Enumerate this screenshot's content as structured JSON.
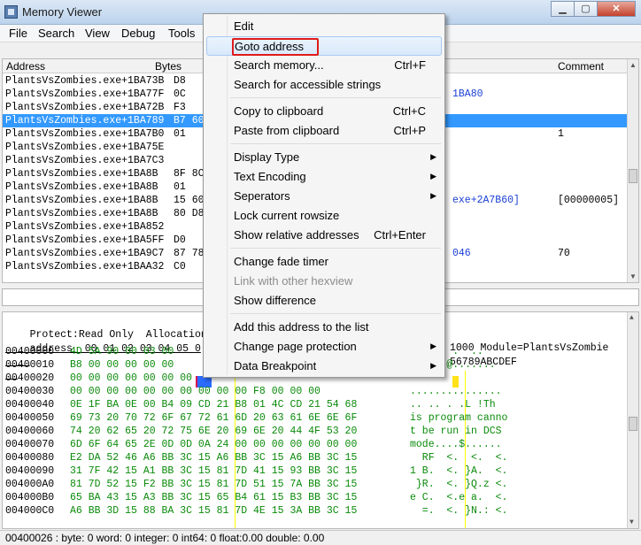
{
  "window": {
    "title": "Memory Viewer",
    "buttons": {
      "minimize": "▁",
      "maximize": "▢",
      "close": "✕"
    }
  },
  "menu": [
    "File",
    "Search",
    "View",
    "Debug",
    "Tools"
  ],
  "disasm": {
    "headers": {
      "address": "Address",
      "bytes": "Bytes",
      "comment": "Comment"
    },
    "rows": [
      {
        "addr": "PlantsVsZombies.exe+1BA73B",
        "bytes": "D8",
        "extra": "",
        "comment": ""
      },
      {
        "addr": "PlantsVsZombies.exe+1BA77F",
        "bytes": "0C",
        "extra": "1BA80",
        "comment": ""
      },
      {
        "addr": "PlantsVsZombies.exe+1BA72B",
        "bytes": "F3",
        "extra": "",
        "comment": ""
      },
      {
        "addr": "PlantsVsZombies.exe+1BA789",
        "bytes": "B7 60",
        "extra": "",
        "comment": ""
      },
      {
        "addr": "PlantsVsZombies.exe+1BA7B0",
        "bytes": "01",
        "extra": "",
        "comment": "1"
      },
      {
        "addr": "PlantsVsZombies.exe+1BA75E",
        "bytes": "",
        "extra": "",
        "comment": ""
      },
      {
        "addr": "PlantsVsZombies.exe+1BA7C3",
        "bytes": "",
        "extra": "",
        "comment": ""
      },
      {
        "addr": "PlantsVsZombies.exe+1BA8B",
        "bytes": "8F 8C",
        "extra": "",
        "comment": ""
      },
      {
        "addr": "PlantsVsZombies.exe+1BA8B",
        "bytes": "01",
        "extra": "",
        "comment": ""
      },
      {
        "addr": "PlantsVsZombies.exe+1BA8B",
        "bytes": "15 60",
        "extra": "exe+2A7B60]",
        "comment": "[00000005]"
      },
      {
        "addr": "PlantsVsZombies.exe+1BA8B",
        "bytes": "80 D8",
        "extra": "",
        "comment": ""
      },
      {
        "addr": "PlantsVsZombies.exe+1BA852",
        "bytes": "",
        "extra": "",
        "comment": ""
      },
      {
        "addr": "PlantsVsZombies.exe+1BA5FF",
        "bytes": "D0",
        "extra": "",
        "comment": ""
      },
      {
        "addr": "PlantsVsZombies.exe+1BA9C7",
        "bytes": "87 78",
        "extra": "046",
        "comment": "70"
      },
      {
        "addr": "PlantsVsZombies.exe+1BAA32",
        "bytes": "C0",
        "extra": "",
        "comment": ""
      }
    ]
  },
  "hex": {
    "info_line": "Protect:Read Only  Allocation",
    "info_tail": "1000 Module=PlantsVsZombie",
    "header": "address  00 01 02 03 04 05 0",
    "header_tail": "56789ABCDEF",
    "rows": [
      {
        "addr": "00400000",
        "bytes": "4D 5A 90 00 03 00",
        "ascii": "..  .. .  .."
      },
      {
        "addr": "00400010",
        "bytes": "B8 00 00 00 00 00",
        "ascii": "......@......."
      },
      {
        "addr": "00400020",
        "bytes": "00 00 00 00 00 00 00",
        "ascii": ""
      },
      {
        "addr": "00400030",
        "bytes": "00 00 00 00 00 00 00 00 00 00 F8 00 00 00",
        "ascii": "..............."
      },
      {
        "addr": "00400040",
        "bytes": "0E 1F BA 0E 00 B4 09 CD 21 B8 01 4C CD 21 54 68",
        "ascii": ".. .. . .L !Th"
      },
      {
        "addr": "00400050",
        "bytes": "69 73 20 70 72 6F 67 72 61 6D 20 63 61 6E 6E 6F",
        "ascii": "is program canno"
      },
      {
        "addr": "00400060",
        "bytes": "74 20 62 65 20 72 75 6E 20 69 6E 20 44 4F 53 20",
        "ascii": "t be run in DCS"
      },
      {
        "addr": "00400070",
        "bytes": "6D 6F 64 65 2E 0D 0D 0A 24 00 00 00 00 00 00 00",
        "ascii": "mode....$......"
      },
      {
        "addr": "00400080",
        "bytes": "E2 DA 52 46 A6 BB 3C 15 A6 BB 3C 15 A6 BB 3C 15",
        "ascii": "  RF  <.  <.  <."
      },
      {
        "addr": "00400090",
        "bytes": "31 7F 42 15 A1 BB 3C 15 81 7D 41 15 93 BB 3C 15",
        "ascii": "1 B.  <. }A.  <."
      },
      {
        "addr": "004000A0",
        "bytes": "81 7D 52 15 F2 BB 3C 15 81 7D 51 15 7A BB 3C 15",
        "ascii": " }R.  <. }Q.z <."
      },
      {
        "addr": "004000B0",
        "bytes": "65 BA 43 15 A3 BB 3C 15 65 B4 61 15 B3 BB 3C 15",
        "ascii": "e C.  <.e a.  <."
      },
      {
        "addr": "004000C0",
        "bytes": "A6 BB 3D 15 88 BA 3C 15 81 7D 4E 15 3A BB 3C 15",
        "ascii": "  =.  <. }N.: <."
      }
    ]
  },
  "status": "00400026 : byte: 0 word: 0 integer: 0 int64: 0 float:0.00 double: 0.00",
  "context_menu": [
    {
      "label": "Edit",
      "shortcut": "",
      "submenu": false,
      "disabled": false
    },
    {
      "label": "Goto address",
      "shortcut": "",
      "submenu": false,
      "disabled": false
    },
    {
      "label": "Search memory...",
      "shortcut": "Ctrl+F",
      "submenu": false,
      "disabled": false
    },
    {
      "label": "Search for accessible strings",
      "shortcut": "",
      "submenu": false,
      "disabled": false
    },
    {
      "label": "Copy to clipboard",
      "shortcut": "Ctrl+C",
      "submenu": false,
      "disabled": false
    },
    {
      "label": "Paste from clipboard",
      "shortcut": "Ctrl+P",
      "submenu": false,
      "disabled": false
    },
    {
      "label": "Display Type",
      "shortcut": "",
      "submenu": true,
      "disabled": false
    },
    {
      "label": "Text Encoding",
      "shortcut": "",
      "submenu": true,
      "disabled": false
    },
    {
      "label": "Seperators",
      "shortcut": "",
      "submenu": true,
      "disabled": false
    },
    {
      "label": "Lock current rowsize",
      "shortcut": "",
      "submenu": false,
      "disabled": false
    },
    {
      "label": "Show relative addresses",
      "shortcut": "Ctrl+Enter",
      "submenu": false,
      "disabled": false
    },
    {
      "label": "Change fade timer",
      "shortcut": "",
      "submenu": false,
      "disabled": false
    },
    {
      "label": "Link with other hexview",
      "shortcut": "",
      "submenu": false,
      "disabled": true
    },
    {
      "label": "Show difference",
      "shortcut": "",
      "submenu": false,
      "disabled": false
    },
    {
      "label": "Add this address to the list",
      "shortcut": "",
      "submenu": false,
      "disabled": false
    },
    {
      "label": "Change page protection",
      "shortcut": "",
      "submenu": true,
      "disabled": false
    },
    {
      "label": "Data Breakpoint",
      "shortcut": "",
      "submenu": true,
      "disabled": false
    }
  ],
  "submenu_arrow": "▶",
  "colors": {
    "selection": "#3399ff",
    "hex_bytes": "#0a8a0a",
    "highlight_box": "#e01b1b"
  }
}
